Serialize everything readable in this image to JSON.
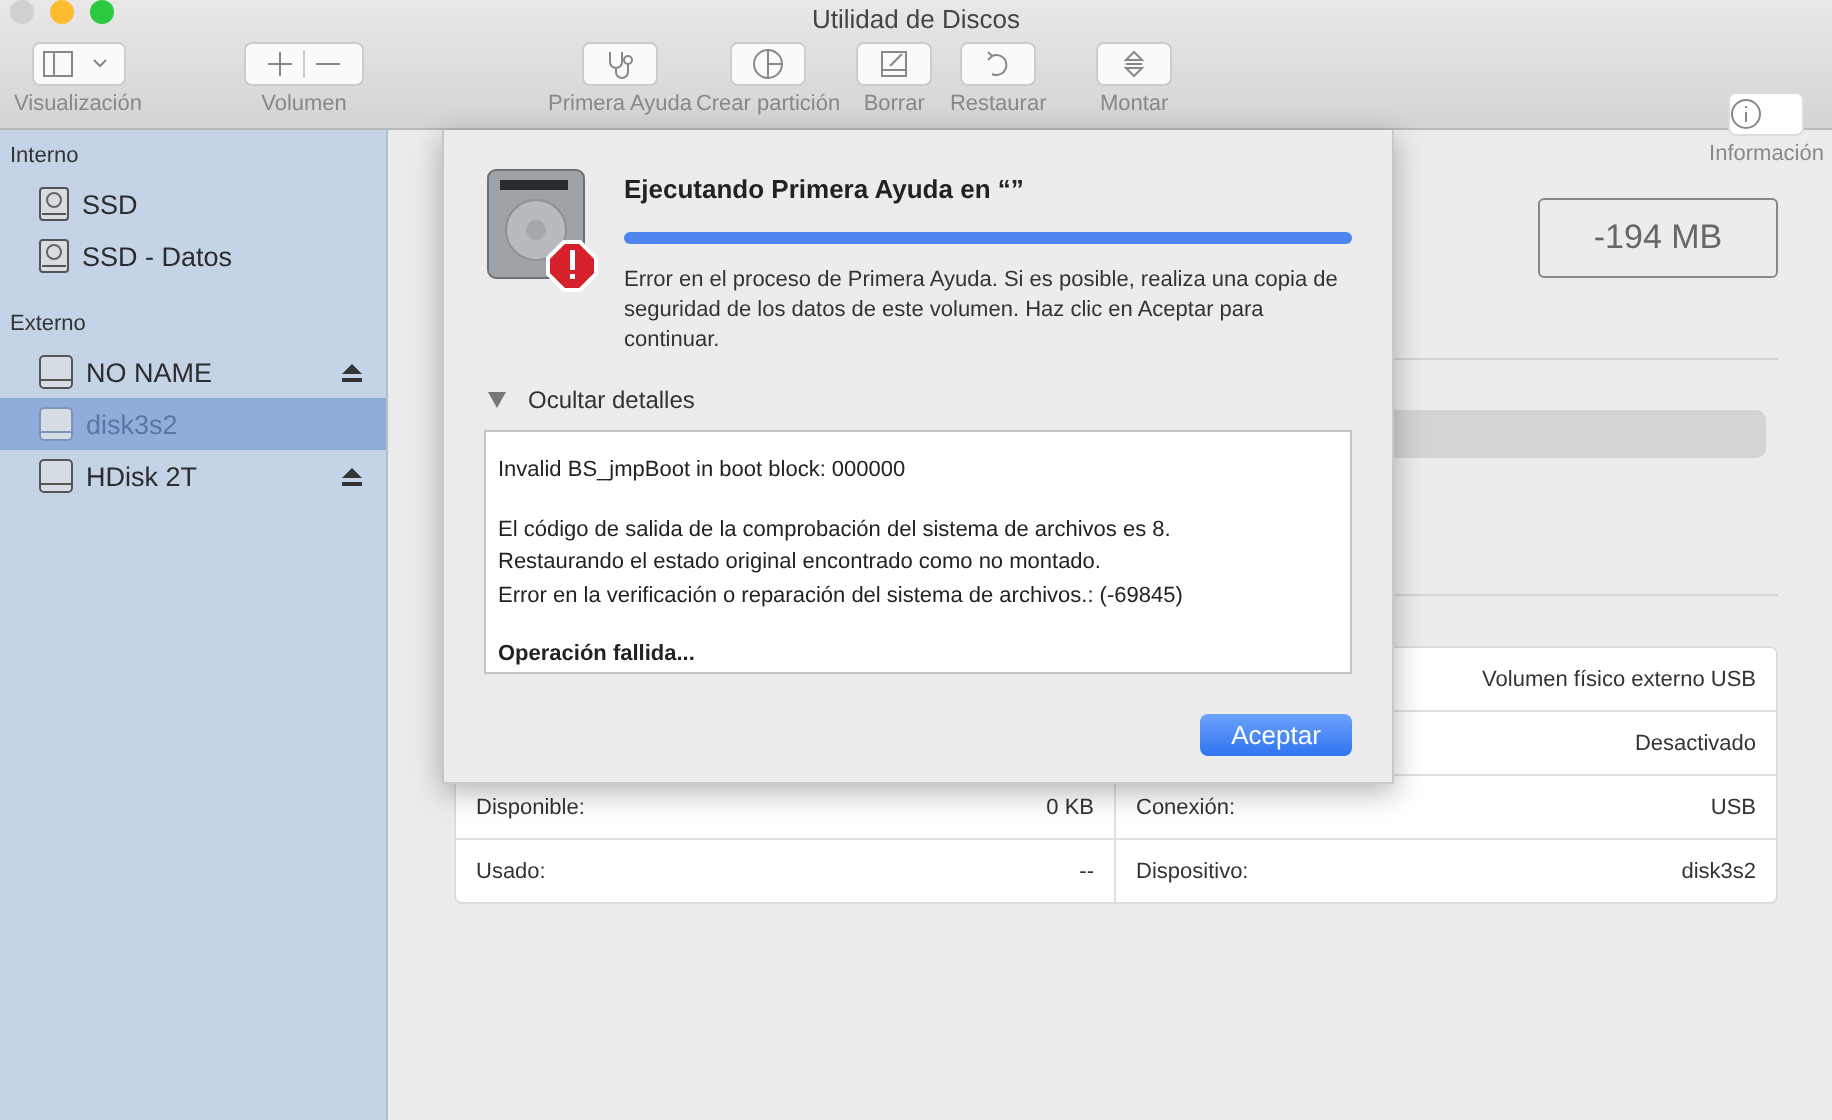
{
  "window": {
    "title": "Utilidad de Discos"
  },
  "toolbar": [
    {
      "kind": "view",
      "label": "Visualización"
    },
    {
      "kind": "volume",
      "label": "Volumen"
    },
    {
      "kind": "firstaid",
      "label": "Primera Ayuda"
    },
    {
      "kind": "partition",
      "label": "Crear partición"
    },
    {
      "kind": "erase",
      "label": "Borrar"
    },
    {
      "kind": "restore",
      "label": "Restaurar"
    },
    {
      "kind": "mount",
      "label": "Montar"
    },
    {
      "kind": "info",
      "label": "Información"
    }
  ],
  "sidebar": {
    "sections": [
      {
        "title": "Interno",
        "items": [
          {
            "name": "SSD",
            "kind": "internal",
            "selected": false,
            "mounted": true,
            "ejectable": false
          },
          {
            "name": "SSD - Datos",
            "kind": "internal",
            "selected": false,
            "mounted": true,
            "ejectable": false
          }
        ]
      },
      {
        "title": "Externo",
        "items": [
          {
            "name": "NO NAME",
            "kind": "external",
            "selected": false,
            "mounted": true,
            "ejectable": true
          },
          {
            "name": "disk3s2",
            "kind": "external",
            "selected": true,
            "mounted": false,
            "ejectable": false
          },
          {
            "name": "HDisk 2T",
            "kind": "external",
            "selected": false,
            "mounted": true,
            "ejectable": true
          }
        ]
      }
    ]
  },
  "volume": {
    "capacity": "-194 MB",
    "info_rows": [
      {
        "right": {
          "value": "Volumen físico externo USB"
        }
      },
      {
        "right": {
          "value": "Desactivado"
        }
      },
      {
        "left": {
          "label": "Disponible:",
          "value": "0 KB"
        },
        "right": {
          "label": "Conexión:",
          "value": "USB"
        }
      },
      {
        "left": {
          "label": "Usado:",
          "value": "--"
        },
        "right": {
          "label": "Dispositivo:",
          "value": "disk3s2"
        }
      }
    ]
  },
  "dialog": {
    "title": "Ejecutando Primera Ayuda en “”",
    "level": 1,
    "message": "Error en el proceso de Primera Ayuda. Si es posible, realiza una copia de seguridad de los datos de este volumen. Haz clic en Aceptar para continuar.",
    "disclosure": {
      "label": "Ocultar detalles",
      "expanded": true
    },
    "details": [
      {
        "kind": "log",
        "lines": [
          "Invalid BS_jmpBoot in boot block: 000000"
        ]
      },
      {
        "kind": "log",
        "lines": [
          "El código de salida de la comprobación del sistema de archivos es 8.",
          "Restaurando el estado original encontrado como no montado.",
          "Error en la verificación o reparación del sistema de archivos.: (-69845)"
        ]
      },
      {
        "kind": "status",
        "lines": [
          "Operación fallida..."
        ]
      }
    ],
    "button": "Aceptar"
  }
}
